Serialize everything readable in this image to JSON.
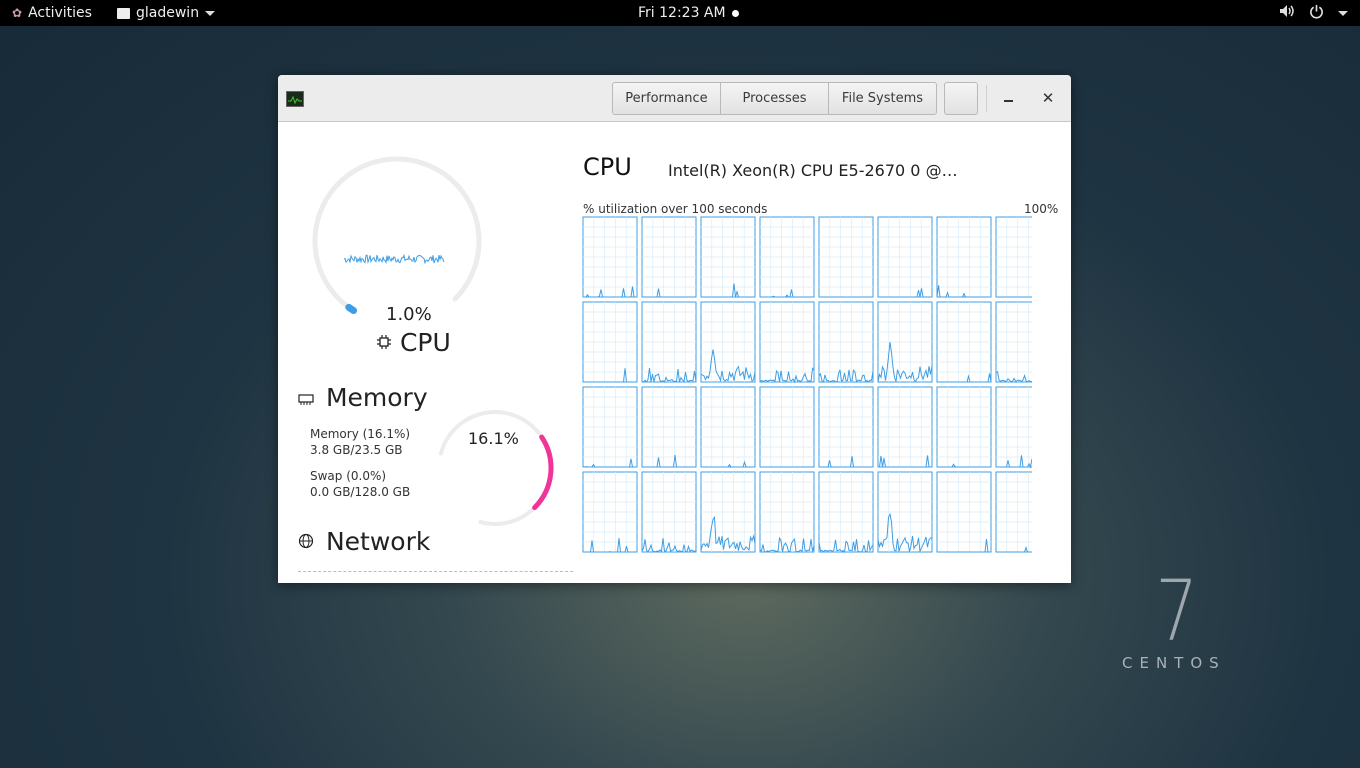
{
  "topbar": {
    "activities": "Activities",
    "app_name": "gladewin",
    "clock": "Fri 12:23 AM"
  },
  "window": {
    "tabs": [
      "Performance",
      "Processes",
      "File Systems"
    ],
    "cpu": {
      "percent": "1.0%",
      "title": "CPU",
      "gauge_fraction": 0.01,
      "color": "#3d9ee5"
    },
    "memory": {
      "title": "Memory",
      "memory_label": "Memory (16.1%)",
      "memory_value": "3.8 GB/23.5 GB",
      "swap_label": "Swap (0.0%)",
      "swap_value": "0.0 GB/128.0 GB",
      "percent": "16.1%",
      "gauge_fraction": 0.161,
      "color": "#f0359a"
    },
    "network": {
      "title": "Network"
    },
    "cpu_panel": {
      "heading": "CPU",
      "model": "Intel(R) Xeon(R) CPU E5-2670 0 @…",
      "utilization_label": "% utilization over 100 seconds",
      "max_label": "100%",
      "core_count": 32,
      "graph_color": "#3d9ee5"
    }
  },
  "desktop": {
    "brand_number": "7",
    "brand_word": "CENTOS"
  }
}
